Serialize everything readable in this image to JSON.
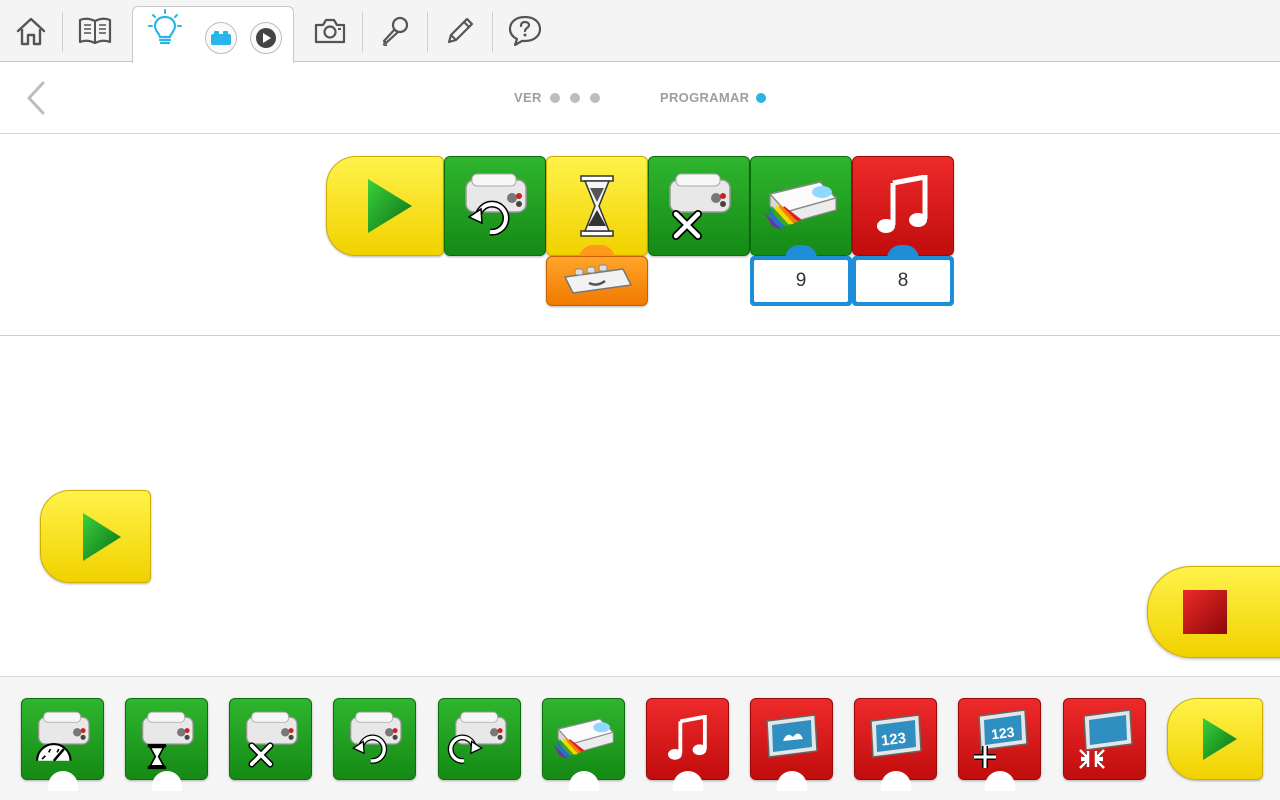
{
  "toolbar": {
    "items": [
      {
        "name": "home",
        "icon": "home-icon"
      },
      {
        "name": "workbook",
        "icon": "book-icon"
      },
      {
        "name": "projects",
        "icon": "lightbulb-icon"
      },
      {
        "name": "camera",
        "icon": "camera-icon"
      },
      {
        "name": "record",
        "icon": "microphone-icon"
      },
      {
        "name": "edit",
        "icon": "pencil-icon"
      },
      {
        "name": "help",
        "icon": "help-bubble-icon"
      }
    ],
    "active_tab_buttons": [
      {
        "name": "hub-connection",
        "icon": "brick-icon",
        "color": "#29b6e6"
      },
      {
        "name": "play-video",
        "icon": "play-circle-icon"
      }
    ]
  },
  "steps": {
    "ver_label": "VER",
    "ver_dots": 3,
    "programar_label": "PROGRAMAR",
    "programar_dots": 1,
    "active_dot_color": "#29b6e6"
  },
  "program": {
    "blocks": [
      {
        "type": "start",
        "icon": "play-triangle-icon"
      },
      {
        "type": "motor-this-way",
        "icon": "motor-counterclockwise-icon"
      },
      {
        "type": "wait-for",
        "icon": "hourglass-icon",
        "input": "tilt-sensor-icon"
      },
      {
        "type": "motor-off",
        "icon": "motor-off-icon"
      },
      {
        "type": "hub-light-color",
        "icon": "hub-color-icon",
        "input": "9"
      },
      {
        "type": "play-sound",
        "icon": "music-note-icon",
        "input": "8"
      }
    ]
  },
  "canvas": {
    "start_block_icon": "play-triangle-icon",
    "stop_button_icon": "stop-square-icon"
  },
  "palette": {
    "blocks": [
      {
        "name": "motor-power",
        "color": "green",
        "icon": "motor-speed-icon"
      },
      {
        "name": "motor-on-for",
        "color": "green",
        "icon": "motor-hourglass-icon"
      },
      {
        "name": "motor-off",
        "color": "green",
        "icon": "motor-off-icon"
      },
      {
        "name": "motor-this-way",
        "color": "green",
        "icon": "motor-counterclockwise-icon"
      },
      {
        "name": "motor-that-way",
        "color": "green",
        "icon": "motor-clockwise-icon"
      },
      {
        "name": "light",
        "color": "green",
        "icon": "hub-color-icon"
      },
      {
        "name": "play-sound",
        "color": "red",
        "icon": "music-note-icon"
      },
      {
        "name": "display-image",
        "color": "red",
        "icon": "display-image-icon"
      },
      {
        "name": "display-number",
        "color": "red",
        "icon": "display-123-icon"
      },
      {
        "name": "add-to-display",
        "color": "red",
        "icon": "display-123-plus-icon"
      },
      {
        "name": "display-minimize",
        "color": "red",
        "icon": "display-shrink-icon"
      },
      {
        "name": "start",
        "color": "yellow",
        "icon": "play-triangle-icon"
      }
    ],
    "program_values": {
      "light_color": "9",
      "sound": "8"
    }
  }
}
